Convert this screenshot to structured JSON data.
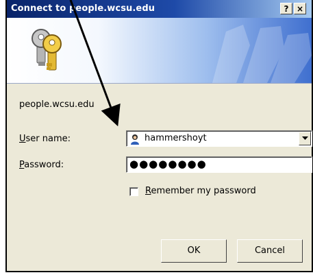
{
  "window": {
    "title": "Connect to people.wcsu.edu",
    "help_label": "?",
    "close_label": "×"
  },
  "dialog": {
    "server_name": "people.wcsu.edu",
    "username_label_mnemonic": "U",
    "username_label_rest": "ser name:",
    "password_label_mnemonic": "P",
    "password_label_rest": "assword:",
    "username_value": "hammershoyt",
    "password_value": "●●●●●●●●",
    "remember_mnemonic": "R",
    "remember_rest": "emember my password",
    "remember_checked": false,
    "ok_label": "OK",
    "cancel_label": "Cancel"
  },
  "icons": [
    "keys-icon",
    "user-icon",
    "dropdown-arrow-icon",
    "help-icon",
    "close-icon"
  ],
  "colors": {
    "titlebar_start": "#0a246a",
    "titlebar_end": "#a6caf0",
    "dialog_face": "#ece9d8",
    "annotation_arrow": "#000000"
  }
}
